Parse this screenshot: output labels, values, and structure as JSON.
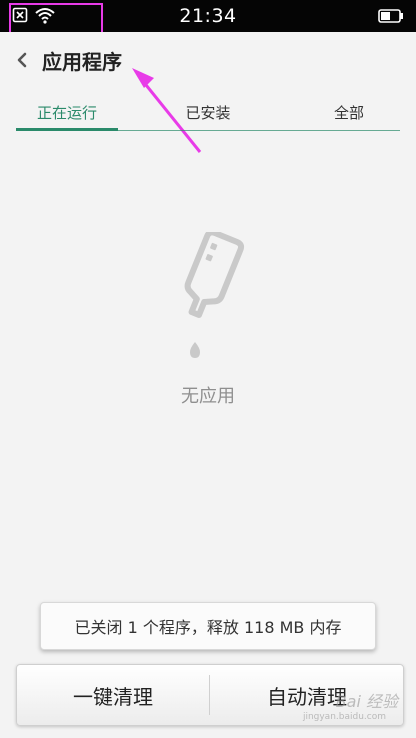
{
  "status_bar": {
    "time": "21:34",
    "icons": [
      "sim-none-icon",
      "wifi-icon",
      "battery-icon"
    ]
  },
  "header": {
    "title": "应用程序",
    "back_icon": "chevron-left-icon"
  },
  "tabs": [
    {
      "label": "正在运行",
      "active": true
    },
    {
      "label": "已安装",
      "active": false
    },
    {
      "label": "全部",
      "active": false
    }
  ],
  "empty_state": {
    "icon": "empty-bottle-icon",
    "text": "无应用"
  },
  "toast": {
    "text": "已关闭 1 个程序，释放 118 MB 内存"
  },
  "bottom_bar": {
    "left_label": "一键清理",
    "right_label": "自动清理"
  },
  "watermark": {
    "text": "Bai 经验",
    "sub": "jingyan.baidu.com"
  },
  "colors": {
    "accent": "#2a8a6a",
    "annotation": "#e83be8",
    "background": "#f3f3f3"
  }
}
